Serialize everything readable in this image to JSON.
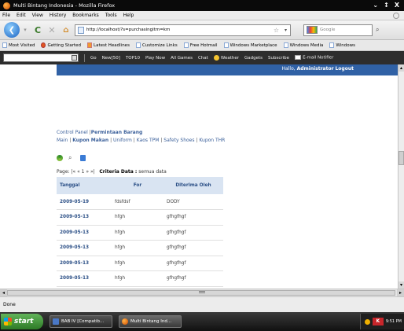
{
  "window": {
    "title": "Multi Bintang Indonesia - Mozilla Firefox",
    "controls": [
      "⌄",
      "↕",
      "X"
    ]
  },
  "menu": [
    "File",
    "Edit",
    "View",
    "History",
    "Bookmarks",
    "Tools",
    "Help"
  ],
  "nav": {
    "url": "http://localhost/?s=purchasingitm=km",
    "search_placeholder": "Google"
  },
  "bookmarks": [
    "Most Visited",
    "Getting Started",
    "Latest Headlines",
    "Customize Links",
    "Free Hotmail",
    "Windows Marketplace",
    "Windows Media",
    "Windows"
  ],
  "toolbar": {
    "search_value": "",
    "go": "Go",
    "items": [
      "New[50]",
      "TOP10",
      "Play Now",
      "All Games",
      "Chat",
      "Weather",
      "Gadgets",
      "Subscribe",
      "E-mail Notifier"
    ]
  },
  "page": {
    "greeting_prefix": "Hallo,",
    "user": "Administrator",
    "logout": "Logout",
    "breadcrumb": {
      "part1": "Control Panel",
      "part2": "Permintaan Barang"
    },
    "subnav": [
      "Main",
      "Kupon Makan",
      "Uniform",
      "Kaos TPM",
      "Safety Shoes",
      "Kupon THR"
    ],
    "pager": {
      "label": "Page:",
      "nav": "|« « 1 » »|",
      "criteria_label": "Criteria Data :",
      "criteria_value": "semua data"
    },
    "table": {
      "headers": [
        "Tanggal",
        "For",
        "Diterima Oleh"
      ],
      "rows": [
        [
          "2009-05-19",
          "fdsfdsf",
          "DODY"
        ],
        [
          "2009-05-13",
          "hfgh",
          "gfhgfhgf"
        ],
        [
          "2009-05-13",
          "hfgh",
          "gfhgfhgf"
        ],
        [
          "2009-05-13",
          "hfgh",
          "gfhgfhgf"
        ],
        [
          "2009-05-13",
          "hfgh",
          "gfhgfhgf"
        ],
        [
          "2009-05-13",
          "hfgh",
          "gfhgfhgf"
        ]
      ]
    }
  },
  "status": "Done",
  "taskbar": {
    "start": "start",
    "tasks": [
      "BAB IV [Compatib...",
      "Multi Bintang Ind..."
    ],
    "clock": "9:51 PM"
  },
  "colors": {
    "header_blue": "#3061a5",
    "link_blue": "#3a5f9a",
    "table_header_bg": "#d9e4f2"
  }
}
